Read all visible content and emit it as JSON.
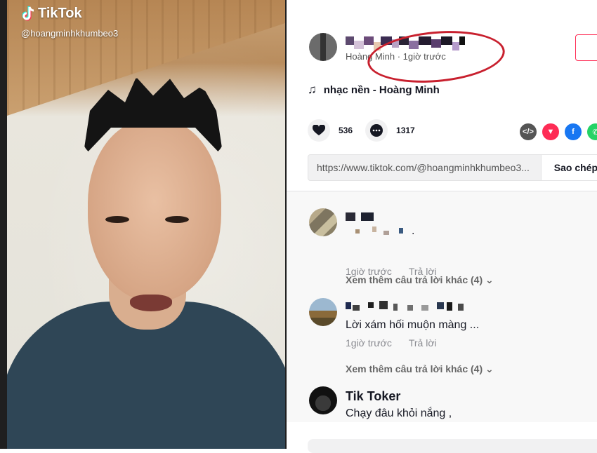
{
  "video": {
    "brand": "TikTok",
    "handle": "@hoangminhkhumbeo3"
  },
  "post": {
    "author_sub": "Hoàng Minh · 1giờ trước",
    "music": "nhạc nền - Hoàng Minh",
    "likes": "536",
    "comments": "1317",
    "link": "https://www.tiktok.com/@hoangminhkhumbeo3...",
    "copy_label": "Sao chép"
  },
  "comments": [
    {
      "text": ".",
      "time": "1giờ trước",
      "reply": "Trả lời",
      "more": "Xem thêm câu trả lời khác (4)"
    },
    {
      "text": "Lời xám hối muộn màng ...",
      "time": "1giờ trước",
      "reply": "Trả lời",
      "more": "Xem thêm câu trả lời khác (4)"
    },
    {
      "name": "Tik Toker",
      "text": "Chạy đâu khỏi nắng ,"
    }
  ],
  "colors": {
    "accent": "#fe2c55",
    "annotation": "#c8202e"
  },
  "icons": {
    "music": "♫",
    "like": "♥",
    "comment": "•••",
    "chevron": "⌄"
  }
}
